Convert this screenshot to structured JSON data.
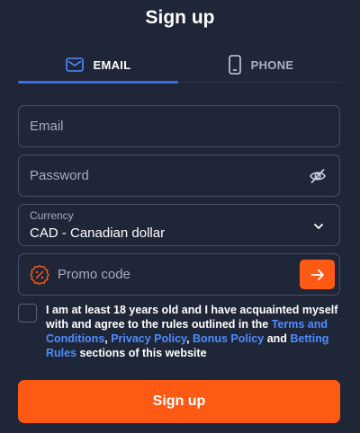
{
  "title": "Sign up",
  "tabs": [
    {
      "label": "EMAIL",
      "icon": "envelope-icon",
      "active": true
    },
    {
      "label": "PHONE",
      "icon": "phone-icon",
      "active": false
    }
  ],
  "form": {
    "email_placeholder": "Email",
    "password_placeholder": "Password",
    "currency_label": "Currency",
    "currency_value": "CAD - Canadian dollar",
    "promo_placeholder": "Promo code"
  },
  "agreement": {
    "text_1": "I am at least 18 years old and I have acquainted myself with and agree to the rules outlined in the ",
    "link_terms": "Terms and Conditions",
    "sep_1": ", ",
    "link_privacy": "Privacy Policy",
    "sep_2": ", ",
    "link_bonus": "Bonus Policy",
    "sep_3": " and ",
    "link_betting": "Betting Rules",
    "text_2": " sections of this website"
  },
  "submit_label": "Sign up",
  "colors": {
    "background": "#1f2638",
    "accent": "#ff5a14",
    "active_tab": "#3b6fe0",
    "link": "#4f8cff"
  }
}
